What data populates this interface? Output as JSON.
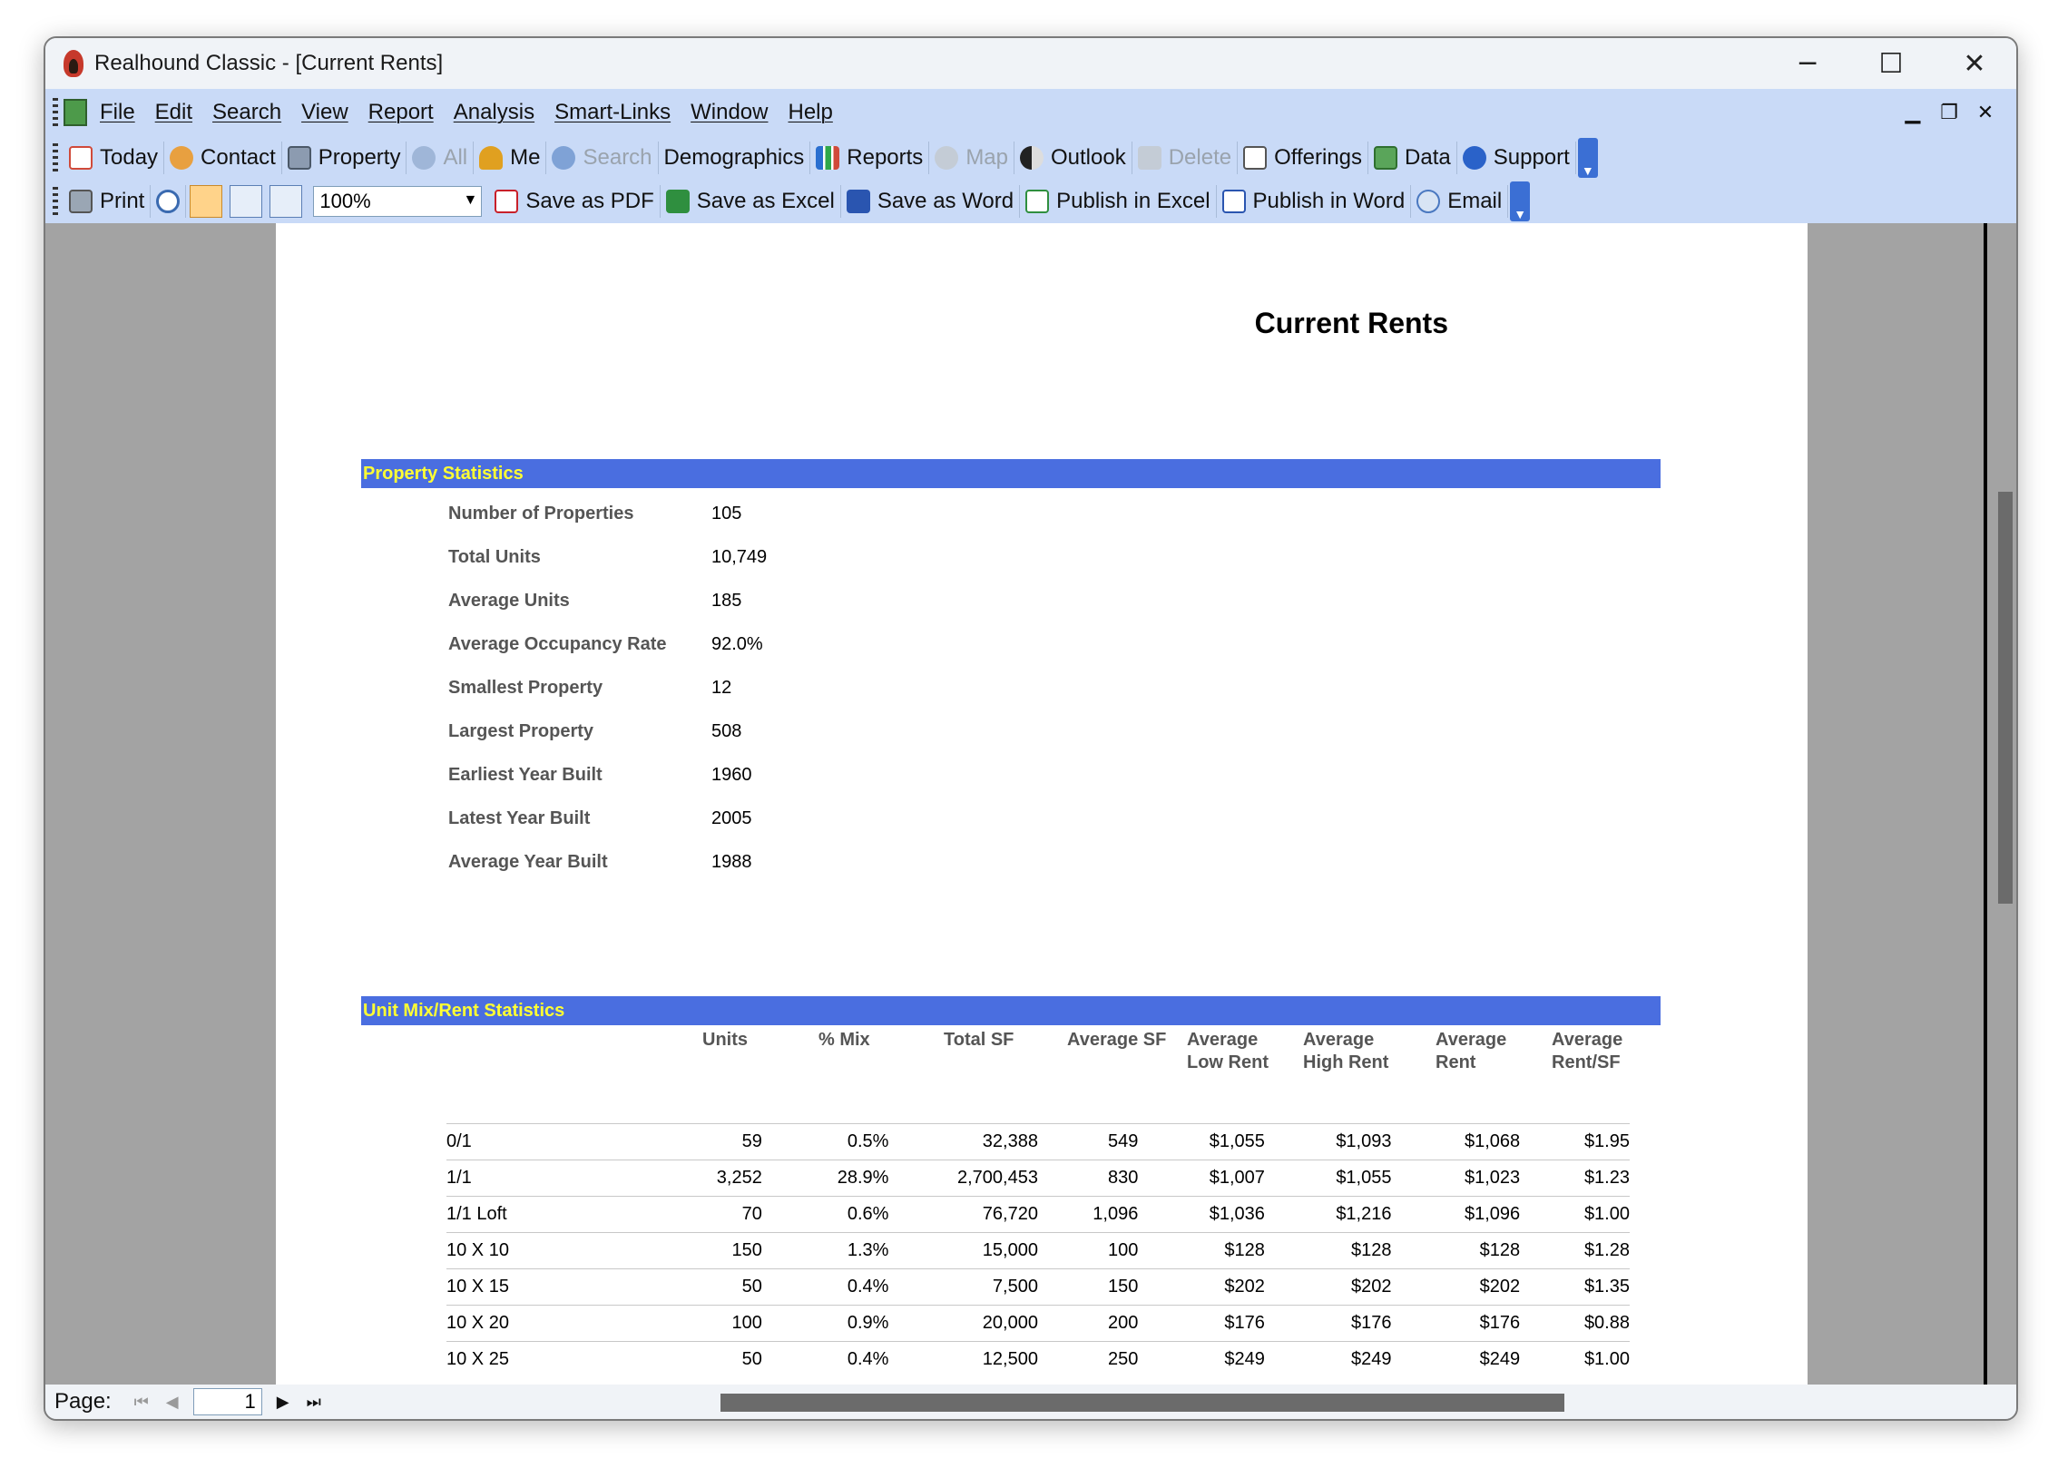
{
  "window": {
    "title": "Realhound Classic - [Current Rents]",
    "controls": {
      "minimize": "─",
      "maximize": "☐",
      "close": "✕"
    }
  },
  "menu": {
    "items": [
      "File",
      "Edit",
      "Search",
      "View",
      "Report",
      "Analysis",
      "Smart-Links",
      "Window",
      "Help"
    ],
    "mdi_controls": {
      "minimize": "▁",
      "restore": "❐",
      "close": "✕"
    }
  },
  "toolbar1": {
    "items": [
      {
        "label": "Today",
        "icon": "calendar-icon",
        "enabled": true
      },
      {
        "label": "Contact",
        "icon": "people-icon",
        "enabled": true
      },
      {
        "label": "Property",
        "icon": "building-icon",
        "enabled": true
      },
      {
        "label": "All",
        "icon": "cloud-icon",
        "enabled": false
      },
      {
        "label": "Me",
        "icon": "person-icon",
        "enabled": true
      },
      {
        "label": "Search",
        "icon": "search-icon",
        "enabled": false
      },
      {
        "label": "Demographics",
        "icon": "",
        "enabled": true
      },
      {
        "label": "Reports",
        "icon": "bar-chart-icon",
        "enabled": true
      },
      {
        "label": "Map",
        "icon": "magnifier-icon",
        "enabled": false
      },
      {
        "label": "Outlook",
        "icon": "yin-yang-icon",
        "enabled": true
      },
      {
        "label": "Delete",
        "icon": "delete-icon",
        "enabled": false
      },
      {
        "label": "Offerings",
        "icon": "list-icon",
        "enabled": true
      },
      {
        "label": "Data",
        "icon": "data-icon",
        "enabled": true
      },
      {
        "label": "Support",
        "icon": "help-icon",
        "enabled": true
      }
    ]
  },
  "toolbar2": {
    "print_label": "Print",
    "zoom_value": "100%",
    "items": [
      {
        "label": "Save as PDF",
        "icon": "pdf-icon"
      },
      {
        "label": "Save as Excel",
        "icon": "excel-icon"
      },
      {
        "label": "Save as Word",
        "icon": "word-icon"
      },
      {
        "label": "Publish in Excel",
        "icon": "excel-publish-icon"
      },
      {
        "label": "Publish in Word",
        "icon": "word-publish-icon"
      },
      {
        "label": "Email",
        "icon": "email-icon"
      }
    ]
  },
  "report": {
    "title": "Current Rents",
    "property_section": "Property Statistics",
    "property_stats": [
      {
        "label": "Number of Properties",
        "value": "105"
      },
      {
        "label": "Total Units",
        "value": "10,749"
      },
      {
        "label": "Average Units",
        "value": "185"
      },
      {
        "label": "Average Occupancy Rate",
        "value": "92.0%"
      },
      {
        "label": "Smallest Property",
        "value": "12"
      },
      {
        "label": "Largest Property",
        "value": "508"
      },
      {
        "label": "Earliest Year Built",
        "value": "1960"
      },
      {
        "label": "Latest Year Built",
        "value": "2005"
      },
      {
        "label": "Average Year Built",
        "value": "1988"
      }
    ],
    "mix_section": "Unit Mix/Rent Statistics",
    "mix_headers": [
      [
        "Units"
      ],
      [
        "% Mix"
      ],
      [
        "Total SF"
      ],
      [
        "Average SF"
      ],
      [
        "Average",
        "Low Rent"
      ],
      [
        "Average",
        "High Rent"
      ],
      [
        "Average",
        "Rent"
      ],
      [
        "Average",
        "Rent/SF"
      ]
    ],
    "mix_rows": [
      [
        "0/1",
        "59",
        "0.5%",
        "32,388",
        "549",
        "$1,055",
        "$1,093",
        "$1,068",
        "$1.95"
      ],
      [
        "1/1",
        "3,252",
        "28.9%",
        "2,700,453",
        "830",
        "$1,007",
        "$1,055",
        "$1,023",
        "$1.23"
      ],
      [
        "1/1 Loft",
        "70",
        "0.6%",
        "76,720",
        "1,096",
        "$1,036",
        "$1,216",
        "$1,096",
        "$1.00"
      ],
      [
        "10 X 10",
        "150",
        "1.3%",
        "15,000",
        "100",
        "$128",
        "$128",
        "$128",
        "$1.28"
      ],
      [
        "10 X 15",
        "50",
        "0.4%",
        "7,500",
        "150",
        "$202",
        "$202",
        "$202",
        "$1.35"
      ],
      [
        "10 X 20",
        "100",
        "0.9%",
        "20,000",
        "200",
        "$176",
        "$176",
        "$176",
        "$0.88"
      ],
      [
        "10 X 25",
        "50",
        "0.4%",
        "12,500",
        "250",
        "$249",
        "$249",
        "$249",
        "$1.00"
      ]
    ]
  },
  "status": {
    "page_label": "Page:",
    "page_number": "1",
    "nav": {
      "first": "⏮",
      "prev": "◀",
      "next": "▶",
      "last": "⏭"
    }
  }
}
